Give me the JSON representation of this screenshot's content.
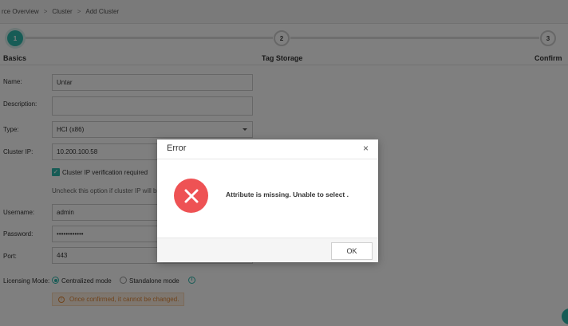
{
  "breadcrumb": {
    "items": [
      "rce Overview",
      "Cluster",
      "Add Cluster"
    ],
    "separator": ">"
  },
  "steps": [
    {
      "number": "1",
      "label": "Basics",
      "state": "active"
    },
    {
      "number": "2",
      "label": "Tag Storage",
      "state": "pending"
    },
    {
      "number": "3",
      "label": "Confirm",
      "state": "pending"
    }
  ],
  "form": {
    "name": {
      "label": "Name:",
      "value": "Untar"
    },
    "description": {
      "label": "Description:",
      "value": ""
    },
    "type": {
      "label": "Type:",
      "value": "HCI (x86)"
    },
    "cluster_ip": {
      "label": "Cluster IP:",
      "value": "10.200.100.58"
    },
    "ip_verification": {
      "label": "Cluster IP verification required",
      "checked": true,
      "hint": "Uncheck this option if cluster IP will be"
    },
    "username": {
      "label": "Username:",
      "value": "admin"
    },
    "password": {
      "label": "Password:",
      "value": "••••••••••••"
    },
    "port": {
      "label": "Port:",
      "value": "443"
    },
    "licensing_mode": {
      "label": "Licensing Mode:",
      "options": [
        {
          "label": "Centralized mode",
          "selected": true
        },
        {
          "label": "Standalone mode",
          "selected": false
        }
      ],
      "info_icon": "info-icon"
    },
    "warning": {
      "icon": "!",
      "text": "Once confirmed, it cannot be changed."
    }
  },
  "dialog": {
    "title": "Error",
    "close_glyph": "×",
    "message": "Attribute is missing. Unable to select .",
    "ok_label": "OK",
    "icon": "error-x-icon"
  },
  "colors": {
    "accent": "#2fb8ac",
    "error": "#ee5254",
    "warning_text": "#e08a3c",
    "overlay": "rgba(0,0,0,0.5)"
  }
}
